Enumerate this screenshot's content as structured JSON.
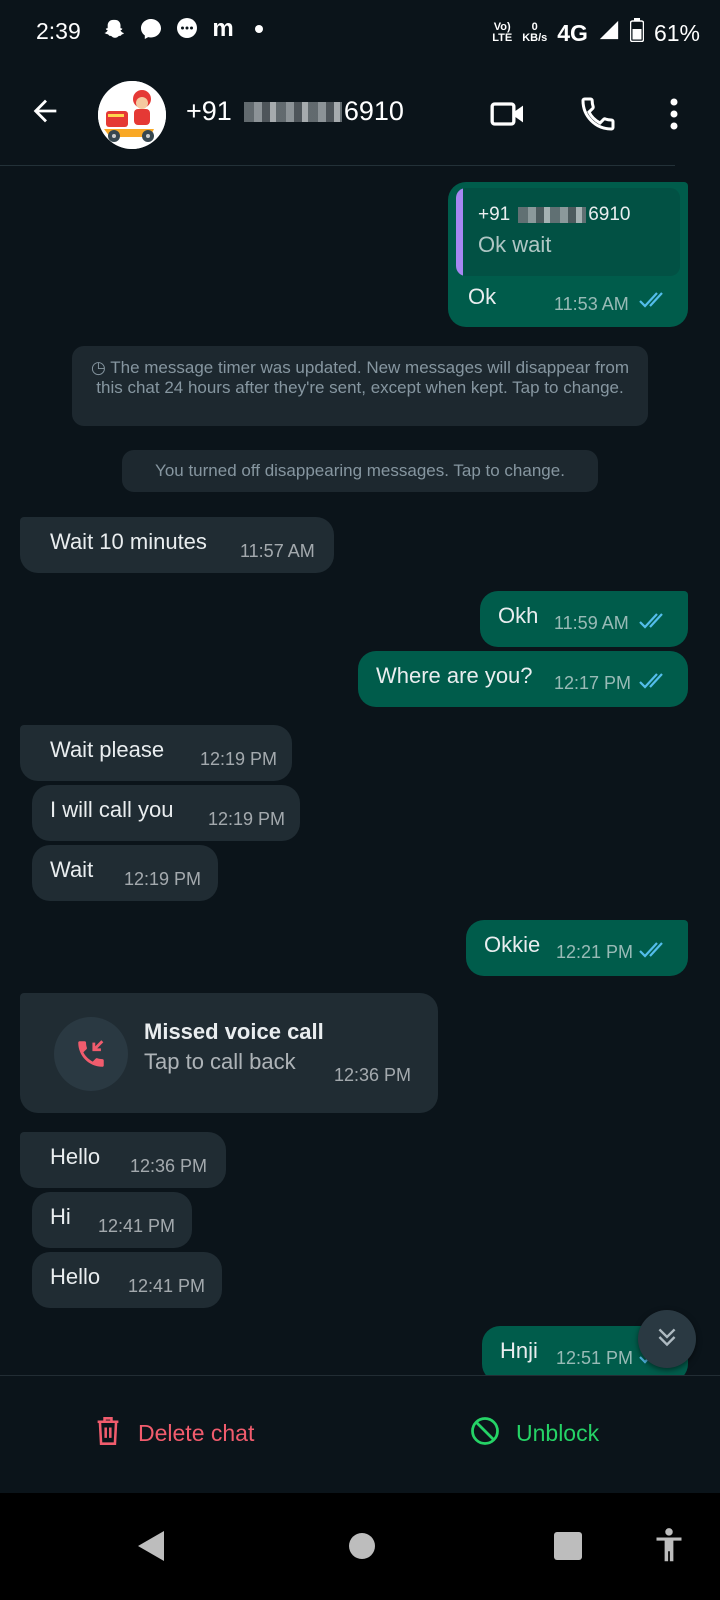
{
  "status_bar": {
    "time": "2:39",
    "lte_label_top": "Vo)",
    "lte_label_bottom": "LTE",
    "data_rate_top": "0",
    "data_rate_bottom": "KB/s",
    "network": "4G",
    "battery": "61%"
  },
  "header": {
    "contact_prefix": "+91",
    "contact_suffix": "6910"
  },
  "messages": {
    "m1": {
      "quote_sender_prefix": "+91",
      "quote_sender_suffix": "6910",
      "quote_text": "Ok wait",
      "text": "Ok",
      "time": "11:53 AM"
    },
    "sys1": "◷ The message timer was updated. New messages will disappear from this chat 24 hours after they're sent, except when kept. Tap to change.",
    "sys2": "You turned off disappearing messages. Tap to change.",
    "m2": {
      "text": "Wait 10 minutes",
      "time": "11:57 AM"
    },
    "m3": {
      "text": "Okh",
      "time": "11:59 AM"
    },
    "m4": {
      "text": "Where are you?",
      "time": "12:17 PM"
    },
    "m5": {
      "text": "Wait please",
      "time": "12:19 PM"
    },
    "m6": {
      "text": "I will call you",
      "time": "12:19 PM"
    },
    "m7": {
      "text": "Wait",
      "time": "12:19 PM"
    },
    "m8": {
      "text": "Okkie",
      "time": "12:21 PM"
    },
    "call": {
      "title": "Missed voice call",
      "subtitle": "Tap to call back",
      "time": "12:36 PM"
    },
    "m9": {
      "text": "Hello",
      "time": "12:36 PM"
    },
    "m10": {
      "text": "Hi",
      "time": "12:41 PM"
    },
    "m11": {
      "text": "Hello",
      "time": "12:41 PM"
    },
    "m12": {
      "text": "Hnji",
      "time": "12:51 PM"
    }
  },
  "actions": {
    "delete_label": "Delete chat",
    "unblock_label": "Unblock"
  },
  "colors": {
    "incoming": "#202c33",
    "outgoing": "#005c4b",
    "read_ticks": "#53bdeb",
    "delete": "#f15c6d",
    "unblock": "#25d366"
  }
}
